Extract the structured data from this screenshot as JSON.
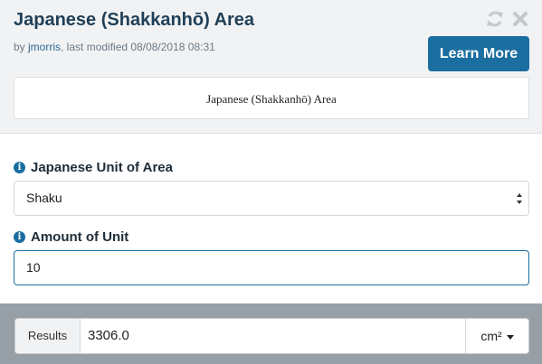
{
  "header": {
    "title": "Japanese (Shakkanhō) Area",
    "byline_prefix": "by ",
    "author": "jmorris",
    "byline_suffix": ", last modified 08/08/2018 08:31",
    "icons": [
      "refresh-icon",
      "close-icon"
    ],
    "learn_more_label": "Learn More",
    "preview_text": "Japanese (Shakkanhō) Area"
  },
  "form": {
    "unit_label": "Japanese Unit of Area",
    "unit_value": "Shaku",
    "amount_label": "Amount of Unit",
    "amount_value": "10",
    "info_glyph": "i"
  },
  "results": {
    "label": "Results",
    "value": "3306.0",
    "unit": "cm²"
  },
  "colors": {
    "accent": "#1b6ea0",
    "title": "#1f3f57",
    "header_bg": "#f1f2f3",
    "results_bar_bg": "#979fa7"
  }
}
